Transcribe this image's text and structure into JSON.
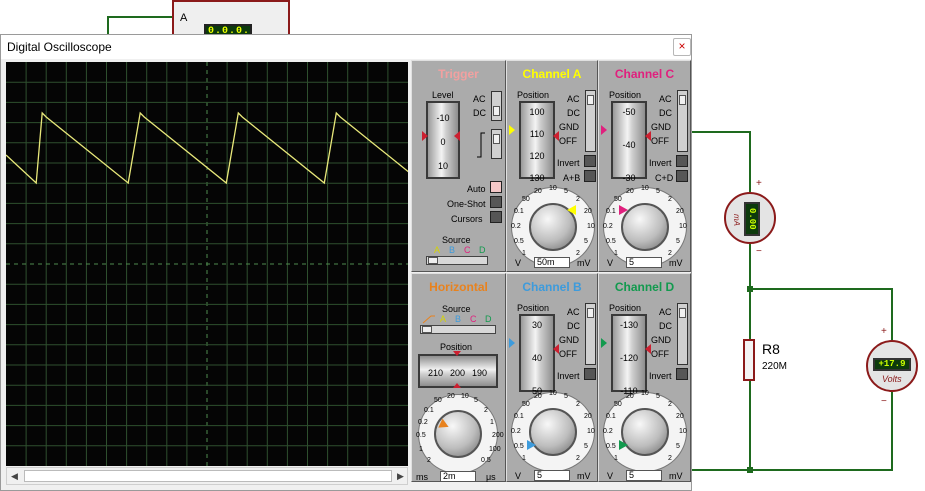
{
  "schematic": {
    "ammeter_top": {
      "label": "A",
      "display": "0.0.0.0.0"
    },
    "milliammeter": {
      "display": "0.00",
      "unit": "mA",
      "plus": "+",
      "minus": "−"
    },
    "voltmeter": {
      "display": "+17.9",
      "unit": "Volts",
      "plus": "+",
      "minus": "−"
    },
    "resistor": {
      "name": "R8",
      "value": "220M"
    }
  },
  "window": {
    "title": "Digital Oscilloscope",
    "close": "×"
  },
  "trigger": {
    "title": "Trigger",
    "level_label": "Level",
    "level_ticks": [
      "-10",
      "0",
      "10"
    ],
    "coupling": [
      "AC",
      "DC"
    ],
    "modes": [
      "Auto",
      "One-Shot",
      "Cursors"
    ],
    "source_label": "Source",
    "source_letters": [
      "A",
      "B",
      "C",
      "D"
    ]
  },
  "channel_a": {
    "title": "Channel A",
    "position_label": "Position",
    "position_ticks": [
      "100",
      "110",
      "120",
      "130"
    ],
    "coupling": [
      "AC",
      "DC",
      "GND",
      "OFF"
    ],
    "invert": "Invert",
    "extra": "A+B",
    "dial_labels": [
      "1",
      "0.5",
      "0.2",
      "0.1",
      "50",
      "20",
      "10",
      "5",
      "2",
      "20",
      "10",
      "5",
      "2"
    ],
    "unit_left": "V",
    "value": "50m",
    "unit_right": "mV"
  },
  "channel_c": {
    "title": "Channel C",
    "position_label": "Position",
    "position_ticks": [
      "-50",
      "-40",
      "-30"
    ],
    "coupling": [
      "AC",
      "DC",
      "GND",
      "OFF"
    ],
    "invert": "Invert",
    "extra": "C+D",
    "dial_labels": [
      "1",
      "0.5",
      "0.2",
      "0.1",
      "50",
      "20",
      "10",
      "5",
      "2",
      "20",
      "10",
      "5",
      "2"
    ],
    "unit_left": "V",
    "value": "5",
    "unit_right": "mV"
  },
  "horizontal": {
    "title": "Horizontal",
    "source_label": "Source",
    "source_letters": [
      "A",
      "B",
      "C",
      "D"
    ],
    "position_label": "Position",
    "position_ticks": [
      "210",
      "200",
      "190"
    ],
    "dial_labels": [
      "2",
      "1",
      "0.5",
      "0.2",
      "0.1",
      "50",
      "20",
      "10",
      "5",
      "2",
      "1",
      "200",
      "100",
      "0.5"
    ],
    "unit_left": "ms",
    "value": "2m",
    "unit_right": "μs"
  },
  "channel_b": {
    "title": "Channel B",
    "position_label": "Position",
    "position_ticks": [
      "30",
      "40",
      "50"
    ],
    "coupling": [
      "AC",
      "DC",
      "GND",
      "OFF"
    ],
    "invert": "Invert",
    "dial_labels": [
      "1",
      "0.5",
      "0.2",
      "0.1",
      "50",
      "20",
      "10",
      "5",
      "2",
      "20",
      "10",
      "5",
      "2"
    ],
    "unit_left": "V",
    "value": "5",
    "unit_right": "mV"
  },
  "channel_d": {
    "title": "Channel D",
    "position_label": "Position",
    "position_ticks": [
      "-130",
      "-120",
      "-110"
    ],
    "coupling": [
      "AC",
      "DC",
      "GND",
      "OFF"
    ],
    "invert": "Invert",
    "dial_labels": [
      "1",
      "0.5",
      "0.2",
      "0.1",
      "50",
      "20",
      "10",
      "5",
      "2",
      "20",
      "10",
      "5",
      "2"
    ],
    "unit_left": "V",
    "value": "5",
    "unit_right": "mV"
  },
  "colors": {
    "screen_bg": "#050505",
    "grid": "#2e4f2e",
    "trace_a": "#e8e87a",
    "channel_a": "#ffff00",
    "channel_b": "#3d9bdc",
    "channel_c": "#e0207e",
    "channel_d": "#129a4e",
    "trigger": "#f2a0a0",
    "horizontal": "#e8821e",
    "wire": "#1e6a1e"
  },
  "trace": {
    "channel": "A",
    "shape": "sawtooth",
    "periods_visible": 4.1,
    "cycle_start_fraction": 0.09
  }
}
